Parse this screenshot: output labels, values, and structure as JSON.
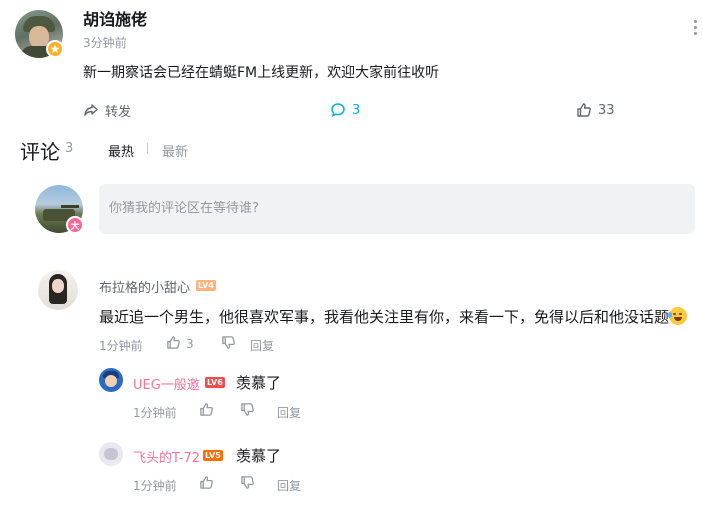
{
  "post": {
    "author": "胡诌施佬",
    "time": "3分钟前",
    "content": "新一期察话会已经在蜻蜓FM上线更新，欢迎大家前往收听",
    "actions": {
      "forward_label": "转发",
      "comment_count": "3",
      "like_count": "33"
    }
  },
  "comments_header": {
    "title": "评论",
    "count": "3",
    "sort_hot": "最热",
    "sort_new": "最新"
  },
  "reply_box": {
    "placeholder": "你猜我的评论区在等待谁?",
    "user_badge": "大"
  },
  "comments": [
    {
      "name": "布拉格的小甜心",
      "level": "LV4",
      "text": "最近追一个男生，他很喜欢军事，我看他关注里有你，来看一下，免得以后和他没话题",
      "time": "1分钟前",
      "like_count": "3",
      "reply_label": "回复",
      "replies": [
        {
          "name": "UEG一般邀",
          "level": "LV6",
          "text": "羡慕了",
          "time": "1分钟前",
          "reply_label": "回复"
        },
        {
          "name": "飞头的T-72",
          "level": "LV5",
          "text": "羡慕了",
          "time": "1分钟前",
          "reply_label": "回复"
        }
      ]
    }
  ],
  "colors": {
    "accent_blue": "#00aeec",
    "username_pink": "#fb7299",
    "muted_gray": "#9499a0",
    "vip_yellow": "#ffb027"
  },
  "icons": [
    "forward-icon",
    "comment-icon",
    "like-icon",
    "dislike-icon",
    "more-icon",
    "vip-badge-icon"
  ]
}
